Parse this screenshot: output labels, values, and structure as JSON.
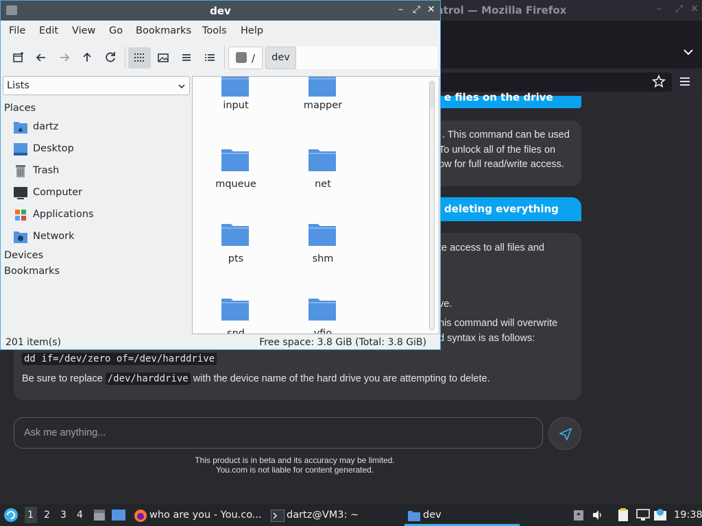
{
  "firefox": {
    "window_title": "ntrol — Mozilla Firefox",
    "content": {
      "heading1": "e files on the drive",
      "para1_lines": [
        ". This command can be used",
        "To unlock all of the files on",
        "ow for full read/write access."
      ],
      "heading2": "deleting everything",
      "para2_lines": [
        "te access to all files and",
        "ve.",
        "his command will overwrite",
        "d syntax is as follows:"
      ],
      "code_line": "dd if=/dev/zero of=/dev/harddrive",
      "replace_prefix": "Be sure to replace ",
      "replace_code": "/dev/harddrive",
      "replace_suffix": " with the device name of the hard drive you are attempting to delete.",
      "ask_placeholder": "Ask me anything...",
      "disclaimer_line1": "This product is in beta and its accuracy may be limited.",
      "disclaimer_line2": "You.com is not liable for content generated."
    }
  },
  "file_manager": {
    "title": "dev",
    "menu": [
      "File",
      "Edit",
      "View",
      "Go",
      "Bookmarks",
      "Tools",
      "Help"
    ],
    "path": {
      "root": "/",
      "current": "dev"
    },
    "sidebar_mode": "Lists",
    "places_heading": "Places",
    "places": [
      {
        "label": "dartz",
        "icon": "home-folder-icon"
      },
      {
        "label": "Desktop",
        "icon": "desktop-icon"
      },
      {
        "label": "Trash",
        "icon": "trash-icon"
      },
      {
        "label": "Computer",
        "icon": "computer-icon"
      },
      {
        "label": "Applications",
        "icon": "applications-icon"
      },
      {
        "label": "Network",
        "icon": "network-icon"
      }
    ],
    "devices_heading": "Devices",
    "bookmarks_heading": "Bookmarks",
    "folders": [
      "input",
      "mapper",
      "mqueue",
      "net",
      "pts",
      "shm",
      "snd",
      "vfio"
    ],
    "status_count": "201 item(s)",
    "status_free": "Free space: 3.8 GiB (Total: 3.8 GiB)",
    "folder_color": "#5294e2"
  },
  "taskbar": {
    "workspaces": [
      "1",
      "2",
      "3",
      "4"
    ],
    "tasks": [
      {
        "label": "who are you - You.co...",
        "icon": "firefox-icon"
      },
      {
        "label": "dartz@VM3: ~",
        "icon": "terminal-icon"
      },
      {
        "label": "dev",
        "icon": "folder-icon"
      }
    ],
    "clock": "19:38"
  }
}
